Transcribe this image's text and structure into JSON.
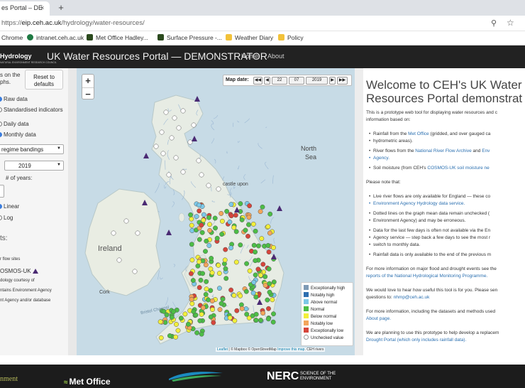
{
  "browser": {
    "tab_title": "es Portal – DE",
    "tab_close": "×",
    "new_tab": "+",
    "url_scheme": "https://",
    "url_host": "eip.ceh.ac.uk",
    "url_path": "/hydrology/water-resources/",
    "zoom_icon": "search-icon",
    "star_icon": "star-icon",
    "bookmarks": [
      {
        "label": "Chrome",
        "color": "#888888"
      },
      {
        "label": "intranet.ceh.ac.uk",
        "color": "#1f7a44"
      },
      {
        "label": "Met Office Hadley...",
        "color": "#2b4a1e"
      },
      {
        "label": "Surface Pressure -...",
        "color": "#2b4a1e"
      },
      {
        "label": "Weather Diary",
        "color": "#f2c23a"
      },
      {
        "label": "Policy",
        "color": "#f2c23a"
      }
    ]
  },
  "navbar": {
    "brand": "Hydrology",
    "brand_sub": "NATURAL ENVIRONMENT RESEARCH COUNCIL",
    "title": "UK Water Resources Portal — DEMONSTRATOR",
    "links": [
      "Home",
      "About"
    ]
  },
  "left_panel": {
    "intro_1": "s on the",
    "intro_2": "phs.",
    "reset_line1": "Reset to",
    "reset_line2": "defaults",
    "data_type": [
      "Raw data",
      "Standardised indicators"
    ],
    "frequency": [
      "Daily data",
      "Monthly data"
    ],
    "bandings_value": "regime bandings",
    "year_value": "2019",
    "years_label": "# of years:",
    "years_stepper": "",
    "scale": [
      "Linear",
      "Log"
    ],
    "layers_heading": "ts:",
    "layer_flow_sites": "r flow sites",
    "layer_cosmos": "OSMOS-UK",
    "credits": [
      "dology courtesy of",
      "ntains Environment Agency",
      "nt Agency and/or database"
    ]
  },
  "map": {
    "zoom_in": "+",
    "zoom_out": "−",
    "date_label": "Map date:",
    "nav_first": "◀◀",
    "nav_prev": "◀",
    "day": "22",
    "month": "07",
    "year": "2019",
    "nav_next": "▶",
    "nav_last": "▶▶",
    "labels": {
      "north_sea_1": "North",
      "north_sea_2": "Sea",
      "ireland": "Ireland",
      "cork": "Cork",
      "newcastle": "castle upon",
      "channel": "Bristol Channel"
    },
    "legend": [
      {
        "label": "Exceptionally high",
        "color": "#7e9ab5"
      },
      {
        "label": "Notably high",
        "color": "#2f6fb0"
      },
      {
        "label": "Above normal",
        "color": "#7cc8e8"
      },
      {
        "label": "Normal",
        "color": "#4cbd46"
      },
      {
        "label": "Below normal",
        "color": "#f2ef3a"
      },
      {
        "label": "Notably low",
        "color": "#f3a55a"
      },
      {
        "label": "Exceptionally low",
        "color": "#d6453b"
      },
      {
        "label": "Unchecked value",
        "color": "#ffffff"
      }
    ],
    "attribution_leaflet": "Leaflet",
    "attribution_rest": "| © Mapbox © OpenStreetMap",
    "attribution_improve": "Improve this map",
    "attribution_ceh": ". CEH rivers"
  },
  "right_panel": {
    "welcome_1": "Welcome to CEH's UK Water",
    "welcome_2": "Resources Portal demonstrat",
    "intro_1": "This is a prototype web tool for displaying water resources and c",
    "intro_2": "information based on:",
    "rainfall_pre": "Rainfall from the",
    "rainfall_link": "Met Office",
    "rainfall_post": "(gridded, and over gauged ca",
    "rainfall_cont": "hydrometric areas).",
    "flows_pre": "River flows from the",
    "flows_link": "National River Flow Archive",
    "flows_mid": "and",
    "flows_link2": "Env",
    "flows_cont": "Agency.",
    "soil_pre": "Soil moisture (from CEH's",
    "soil_link": "COSMOS-UK soil moisture ne",
    "note": "Please note that:",
    "n1_a": "Live river flows are only available for England — these co",
    "n1_b": "Environment Agency Hydrology data service.",
    "n2_a": "Dotted lines on the graph mean data remain unchecked (",
    "n2_b": "Environment Agency) and may be erroneous.",
    "n3_a": "Data for the last few days is often not available via the En",
    "n3_b": "Agency service — step back a few days to see the most r",
    "n3_c": "switch to monthly data.",
    "n4": "Rainfall data is only available to the end of the previous m",
    "more_1": "For more information on major flood and drought events see the",
    "more_2": "reports of the National Hydrological Monitoring Programme.",
    "hear_1": "We would love to hear how useful this tool is for you. Please sen",
    "hear_2_pre": "questions to:",
    "hear_2_link": "nhmp@ceh.ac.uk",
    "datasets_1": "For more information, including the datasets and methods used",
    "datasets_2": "About page.",
    "planning_1": "We are planning to use this prototype to help develop a replacem",
    "planning_2": "Drought Portal (which only includes rainfall data)."
  },
  "footer": {
    "env": "nment",
    "metoffice": "Met Office",
    "nerc": "NERC",
    "nerc_sub1": "SCIENCE OF THE",
    "nerc_sub2": "ENVIRONMENT"
  }
}
